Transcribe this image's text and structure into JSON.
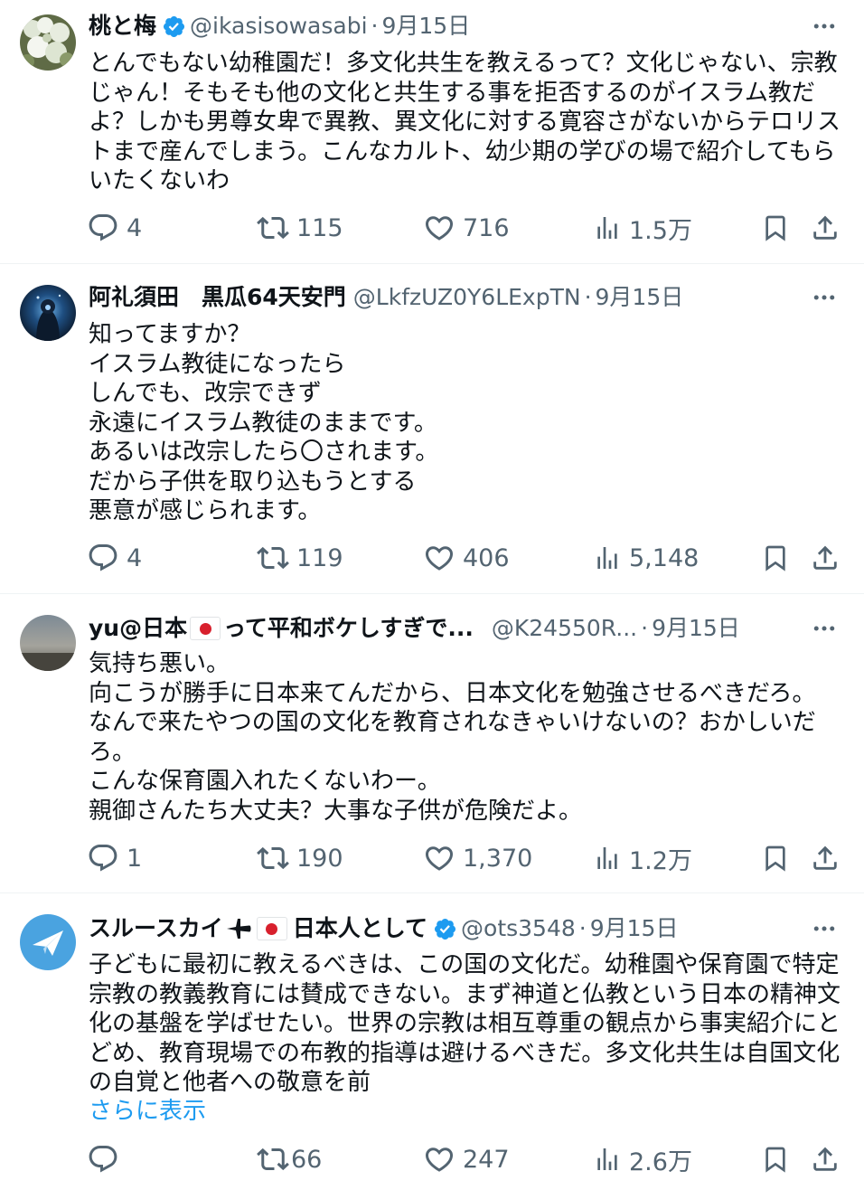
{
  "tweets": [
    {
      "name": "桃と梅",
      "verified": true,
      "handle": "@ikasisowasabi",
      "date": "9月15日",
      "text": "とんでもない幼稚園だ！多文化共生を教えるって？文化じゃない、宗教じゃん！そもそも他の文化と共生する事を拒否するのがイスラム教だよ？しかも男尊女卑で異教、異文化に対する寛容さがないからテロリストまで産んでしまう。こんなカルト、幼少期の学びの場で紹介してもらいたくないわ",
      "replies": "4",
      "retweets": "115",
      "likes": "716",
      "views": "1.5万"
    },
    {
      "name": "阿礼須田　黒瓜64天安門",
      "verified": false,
      "handle": "@LkfzUZ0Y6LExpTN",
      "date": "9月15日",
      "text": "知ってますか？\nイスラム教徒になったら\nしんでも、改宗できず\n永遠にイスラム教徒のままです。\nあるいは改宗したら〇されます。\nだから子供を取り込もうとする\n悪意が感じられます。",
      "replies": "4",
      "retweets": "119",
      "likes": "406",
      "views": "5,148"
    },
    {
      "name_part1": "yu@日本",
      "name_part2": "って平和ボケしすぎで...",
      "verified": false,
      "handle": "@K24550R...",
      "date": "9月15日",
      "text": "気持ち悪い。\n向こうが勝手に日本来てんだから、日本文化を勉強させるべきだろ。\nなんで来たやつの国の文化を教育されなきゃいけないの？おかしいだろ。\nこんな保育園入れたくないわー。\n親御さんたち大丈夫？大事な子供が危険だよ。",
      "replies": "1",
      "retweets": "190",
      "likes": "1,370",
      "views": "1.2万"
    },
    {
      "name_part1": "スルースカイ",
      "name_part2": "日本人として",
      "verified": true,
      "handle": "@ots3548",
      "date": "9月15日",
      "text": "子どもに最初に教えるべきは、この国の文化だ。幼稚園や保育園で特定宗教の教義教育には賛成できない。まず神道と仏教という日本の精神文化の基盤を学ばせたい。世界の宗教は相互尊重の観点から事実紹介にとどめ、教育現場での布教的指導は避けるべきだ。多文化共生は自国文化の自覚と他者への敬意を前",
      "show_more": "さらに表示",
      "replies": "",
      "retweets": "66",
      "likes": "247",
      "views": "2.6万"
    }
  ],
  "separator": "·",
  "colors": {
    "text": "#0f1419",
    "secondary": "#536471",
    "link": "#1d9bf0",
    "verified": "#1d9bf0",
    "flag_red": "#d8202d"
  },
  "icons": [
    "reply-icon",
    "retweet-icon",
    "like-icon",
    "views-icon",
    "bookmark-icon",
    "share-icon",
    "more-icon",
    "verified-badge-icon",
    "airplane-icon",
    "japan-flag-icon"
  ]
}
